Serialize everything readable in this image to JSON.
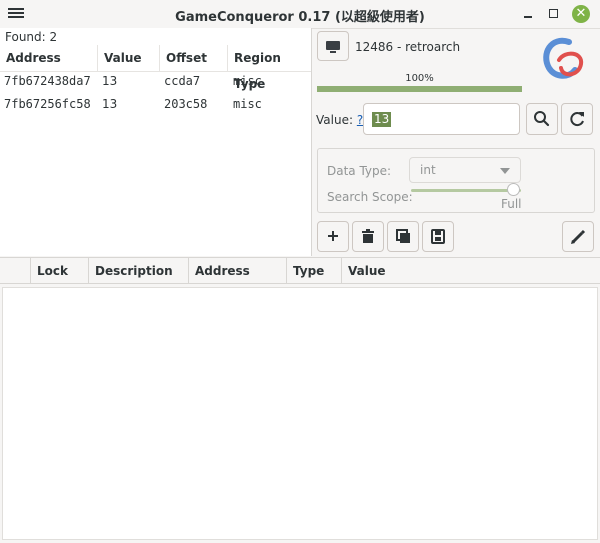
{
  "window": {
    "title": "GameConqueror 0.17 (以超級使用者)"
  },
  "results": {
    "found_label": "Found: 2",
    "columns": [
      "Address",
      "Value",
      "Offset",
      "Region Type"
    ],
    "rows": [
      [
        "7fb672438da7",
        "13",
        "ccda7",
        "misc"
      ],
      [
        "7fb67256fc58",
        "13",
        "203c58",
        "misc"
      ]
    ]
  },
  "process": {
    "name": "12486 - retroarch"
  },
  "progress": {
    "label": "100%",
    "value": 1.0
  },
  "search": {
    "value_label": "Value:",
    "help_link": "?",
    "value": "13"
  },
  "options": {
    "data_type_label": "Data Type:",
    "data_type_value": "int",
    "search_scope_label": "Search Scope:",
    "search_scope_value": "Full"
  },
  "cheat_list": {
    "columns": [
      "Lock",
      "Description",
      "Address",
      "Type",
      "Value"
    ]
  },
  "colors": {
    "accent_green": "#8fae73",
    "close_button": "#7fb347",
    "selection": "#6e8c4e"
  }
}
